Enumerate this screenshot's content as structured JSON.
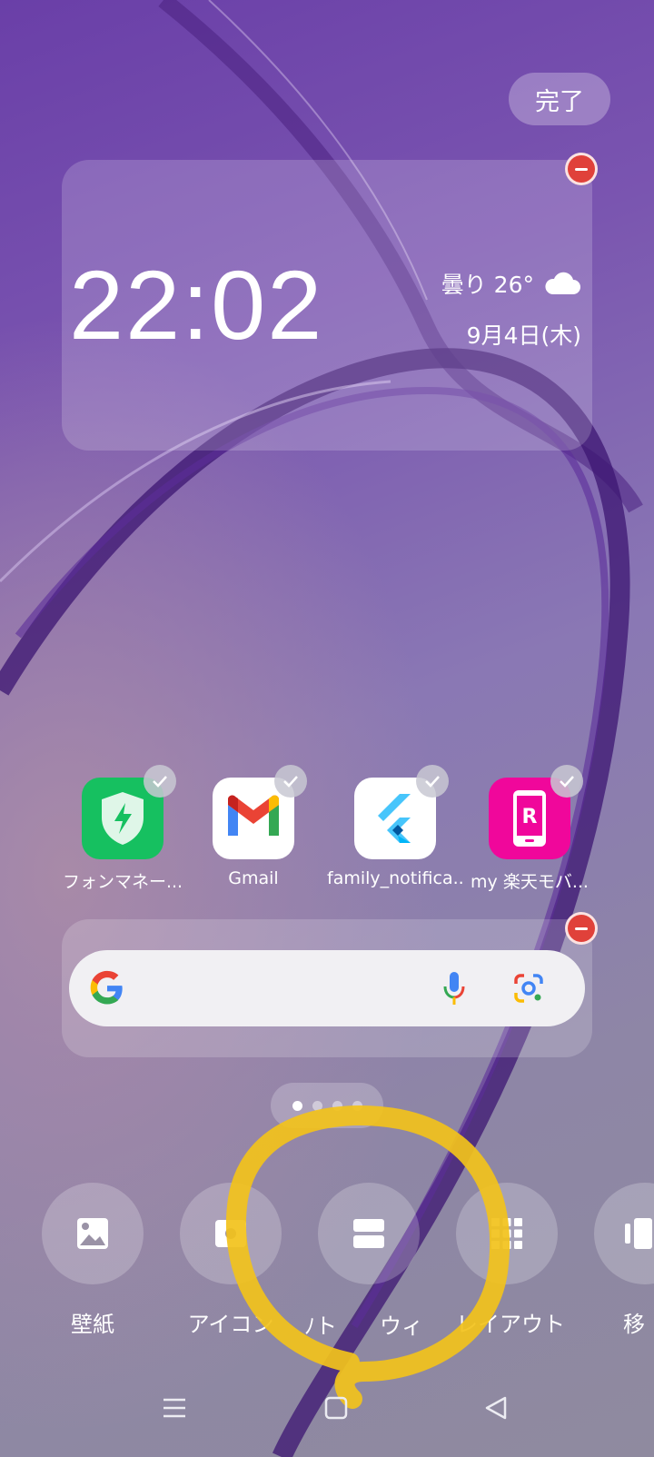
{
  "header": {
    "done_label": "完了"
  },
  "clock_widget": {
    "time": "22:02",
    "weather": "曇り 26°",
    "date": "9月4日(木)"
  },
  "apps": [
    {
      "label": "フォンマネー...",
      "icon": "phone-manager-icon"
    },
    {
      "label": "Gmail",
      "icon": "gmail-icon"
    },
    {
      "label": "family_notifica...",
      "icon": "flutter-icon"
    },
    {
      "label": "my 楽天モバ...",
      "icon": "rakuten-icon"
    }
  ],
  "search_widget": {
    "icons": [
      "google-g-icon",
      "microphone-icon",
      "google-lens-icon"
    ]
  },
  "pager": {
    "count": 4,
    "active": 0
  },
  "toolbar": [
    {
      "label": "壁紙",
      "icon": "wallpaper-icon"
    },
    {
      "label": "アイコン",
      "icon": "icon-style-icon"
    },
    {
      "label": "ﾉト",
      "icon": ""
    },
    {
      "label": "ウィ",
      "icon": "widgets-icon"
    },
    {
      "label": "レイアウト",
      "icon": "layout-grid-icon"
    },
    {
      "label": "移",
      "icon": "move-icon"
    }
  ],
  "navbar": {
    "icons": [
      "menu-icon",
      "home-icon",
      "back-icon"
    ]
  },
  "colors": {
    "remove": "#e0413a",
    "annotation": "#f2c21b",
    "gmail_red": "#ea4335"
  }
}
